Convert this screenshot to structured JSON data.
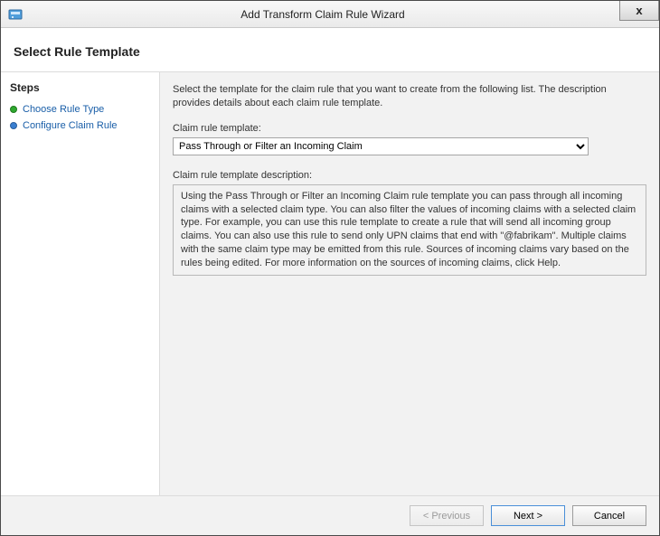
{
  "window": {
    "title": "Add Transform Claim Rule Wizard",
    "close": "x"
  },
  "header": {
    "heading": "Select Rule Template"
  },
  "sidebar": {
    "title": "Steps",
    "items": [
      {
        "label": "Choose Rule Type",
        "state": "done"
      },
      {
        "label": "Configure Claim Rule",
        "state": "pending"
      }
    ]
  },
  "main": {
    "intro": "Select the template for the claim rule that you want to create from the following list. The description provides details about each claim rule template.",
    "template_label": "Claim rule template:",
    "template_selected": "Pass Through or Filter an Incoming Claim",
    "description_label": "Claim rule template description:",
    "description_text": "Using the Pass Through or Filter an Incoming Claim rule template you can pass through all incoming claims with a selected claim type.  You can also filter the values of incoming claims with a selected claim type.  For example, you can use this rule template to create a rule that will send all incoming group claims.  You can also use this rule to send only UPN claims that end with \"@fabrikam\".  Multiple claims with the same claim type may be emitted from this rule.  Sources of incoming claims vary based on the rules being edited.  For more information on the sources of incoming claims, click Help."
  },
  "footer": {
    "previous": "< Previous",
    "next": "Next >",
    "cancel": "Cancel"
  }
}
